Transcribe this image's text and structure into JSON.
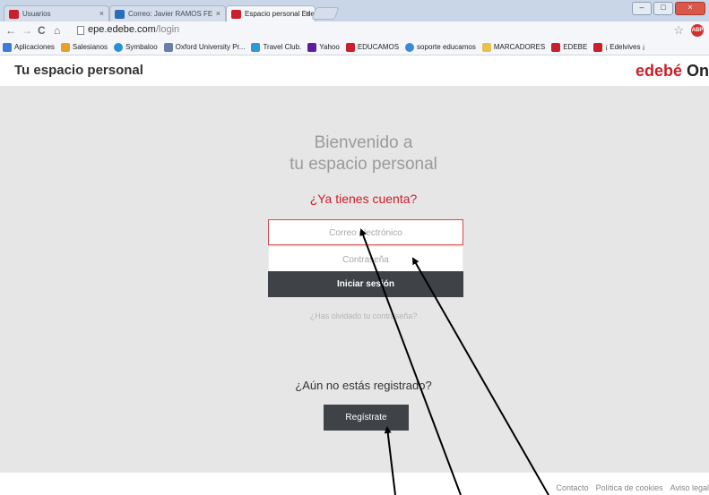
{
  "browser": {
    "tabs": [
      {
        "label": "Usuarios",
        "icon_color": "#c9202b"
      },
      {
        "label": "Correo: Javier RAMOS FE",
        "icon_color": "#2a6db8"
      },
      {
        "label": "Espacio personal Edebé",
        "icon_color": "#c9202b"
      }
    ],
    "url_host": "epe.edebe.com",
    "url_path": "/login",
    "bookmarks": [
      {
        "label": "Aplicaciones",
        "color": "#3b7dd8"
      },
      {
        "label": "Salesianos",
        "color": "#e8a02a"
      },
      {
        "label": "Symbaloo",
        "color": "#2a8fd8"
      },
      {
        "label": "Oxford University Pr...",
        "color": "#6a7fa8"
      },
      {
        "label": "Travel Club.",
        "color": "#2a9ad8"
      },
      {
        "label": "Yahoo",
        "color": "#5b1f9e"
      },
      {
        "label": "EDUCAMOS",
        "color": "#c9202b"
      },
      {
        "label": "soporte educamos",
        "color": "#3b8ad8"
      },
      {
        "label": "MARCADORES",
        "color": "#e8c04a"
      },
      {
        "label": "EDEBE",
        "color": "#c9202b"
      },
      {
        "label": "¡ Edelvives ¡",
        "color": "#c9202b"
      }
    ]
  },
  "header": {
    "title": "Tu espacio personal",
    "brand": "edebé",
    "brand_suffix": "On"
  },
  "login": {
    "welcome_line1": "Bienvenido a",
    "welcome_line2": "tu espacio personal",
    "have_account": "¿Ya tienes cuenta?",
    "email_placeholder": "Correo electrónico",
    "password_placeholder": "Contraseña",
    "login_button": "Iniciar sesión",
    "forgot": "¿Has olvidado tu contraseña?",
    "not_registered": "¿Aún no estás registrado?",
    "register_button": "Regístrate"
  },
  "footer": {
    "links": [
      "Contacto",
      "Política de cookies",
      "Aviso legal"
    ]
  },
  "colors": {
    "accent": "#c9202b",
    "button": "#3f4247",
    "background": "#e6e6e6"
  }
}
